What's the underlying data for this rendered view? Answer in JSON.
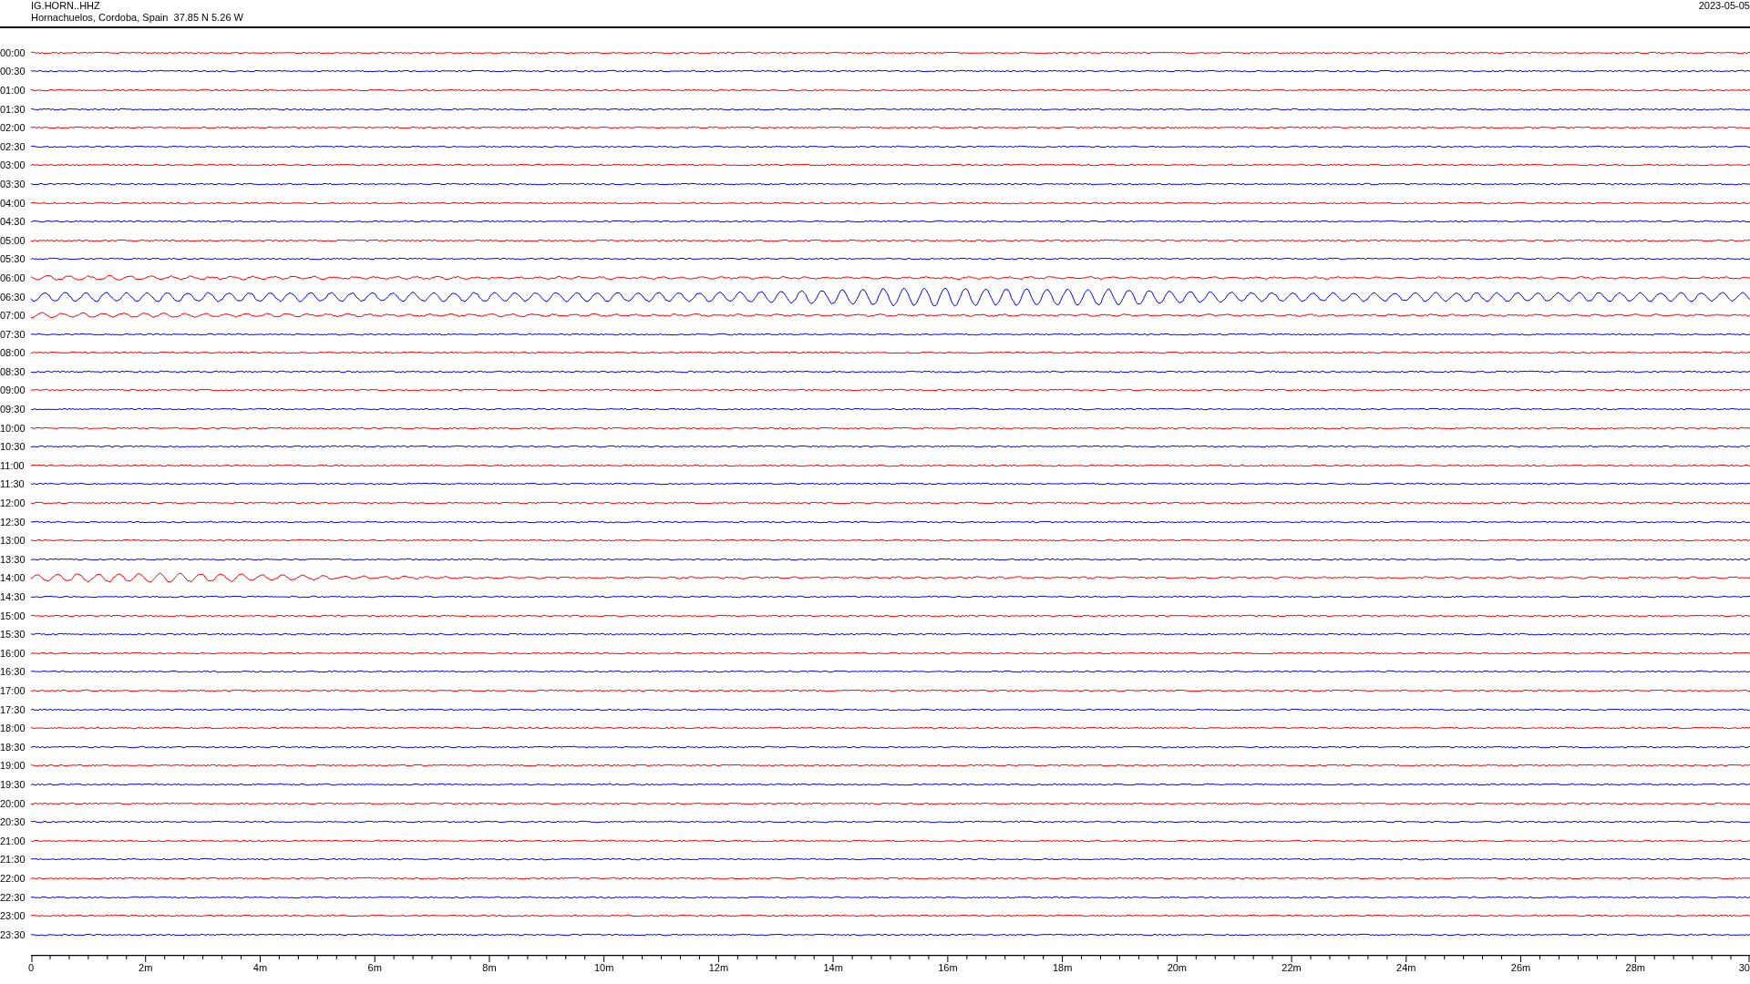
{
  "header": {
    "station": "IG.HORN..HHZ",
    "location": "Hornachuelos, Cordoba, Spain  37.85 N 5.26 W",
    "date": "2023-05-05"
  },
  "traces": [
    {
      "time": "00:00",
      "color": "#ff0000"
    },
    {
      "time": "00:30",
      "color": "#0000ff"
    },
    {
      "time": "01:00",
      "color": "#ff0000"
    },
    {
      "time": "01:30",
      "color": "#0000ff"
    },
    {
      "time": "02:00",
      "color": "#ff0000"
    },
    {
      "time": "02:30",
      "color": "#0000ff"
    },
    {
      "time": "03:00",
      "color": "#ff0000"
    },
    {
      "time": "03:30",
      "color": "#0000ff"
    },
    {
      "time": "04:00",
      "color": "#ff0000"
    },
    {
      "time": "04:30",
      "color": "#0000ff"
    },
    {
      "time": "05:00",
      "color": "#ff0000"
    },
    {
      "time": "05:30",
      "color": "#0000ff"
    },
    {
      "time": "06:00",
      "color": "#ff0000"
    },
    {
      "time": "06:30",
      "color": "#0000ff"
    },
    {
      "time": "07:00",
      "color": "#ff0000"
    },
    {
      "time": "07:30",
      "color": "#0000ff"
    },
    {
      "time": "08:00",
      "color": "#ff0000"
    },
    {
      "time": "08:30",
      "color": "#0000ff"
    },
    {
      "time": "09:00",
      "color": "#ff0000"
    },
    {
      "time": "09:30",
      "color": "#0000ff"
    },
    {
      "time": "10:00",
      "color": "#ff0000"
    },
    {
      "time": "10:30",
      "color": "#0000ff"
    },
    {
      "time": "11:00",
      "color": "#ff0000"
    },
    {
      "time": "11:30",
      "color": "#0000ff"
    },
    {
      "time": "12:00",
      "color": "#ff0000"
    },
    {
      "time": "12:30",
      "color": "#0000ff"
    },
    {
      "time": "13:00",
      "color": "#ff0000"
    },
    {
      "time": "13:30",
      "color": "#0000ff"
    },
    {
      "time": "14:00",
      "color": "#ff0000"
    },
    {
      "time": "14:30",
      "color": "#0000ff"
    },
    {
      "time": "15:00",
      "color": "#ff0000"
    },
    {
      "time": "15:30",
      "color": "#0000ff"
    },
    {
      "time": "16:00",
      "color": "#ff0000"
    },
    {
      "time": "16:30",
      "color": "#0000ff"
    },
    {
      "time": "17:00",
      "color": "#ff0000"
    },
    {
      "time": "17:30",
      "color": "#0000ff"
    },
    {
      "time": "18:00",
      "color": "#ff0000"
    },
    {
      "time": "18:30",
      "color": "#0000ff"
    },
    {
      "time": "19:00",
      "color": "#ff0000"
    },
    {
      "time": "19:30",
      "color": "#0000ff"
    },
    {
      "time": "20:00",
      "color": "#ff0000"
    },
    {
      "time": "20:30",
      "color": "#0000ff"
    },
    {
      "time": "21:00",
      "color": "#ff0000"
    },
    {
      "time": "21:30",
      "color": "#0000ff"
    },
    {
      "time": "22:00",
      "color": "#ff0000"
    },
    {
      "time": "22:30",
      "color": "#0000ff"
    },
    {
      "time": "23:00",
      "color": "#ff0000"
    },
    {
      "time": "23:30",
      "color": "#0000ff"
    }
  ],
  "axis": {
    "labels": [
      "0",
      "2m",
      "4m",
      "6m",
      "8m",
      "10m",
      "12m",
      "14m",
      "16m",
      "18m",
      "20m",
      "22m",
      "24m",
      "26m",
      "28m",
      "30"
    ]
  }
}
